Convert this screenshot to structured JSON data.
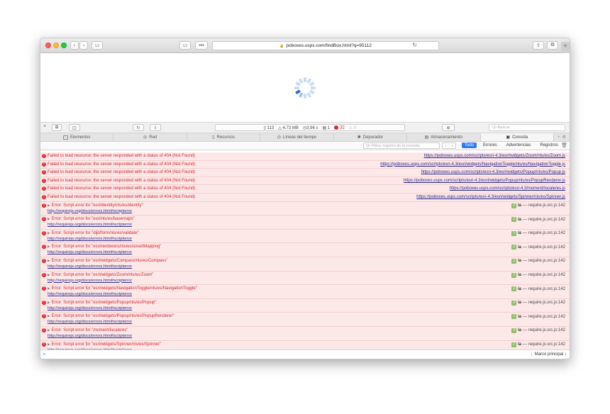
{
  "browser": {
    "url": "poboxes.usps.com/findBox.html?q=95112",
    "reader_label": "▭",
    "tabs_label": "•••|"
  },
  "devtools": {
    "stats": {
      "resources": "113",
      "size": "4,73 MB",
      "time": "3,96 s",
      "logs": "1",
      "errors": "32",
      "warnings": "0"
    },
    "search_placeholder": "Q• Buscar",
    "tabs": [
      {
        "label": "Elementos"
      },
      {
        "label": "Red"
      },
      {
        "label": "Recursos"
      },
      {
        "label": "Líneas del tiempo"
      },
      {
        "label": "Depurador"
      },
      {
        "label": "Almacenamiento"
      },
      {
        "label": "Consola"
      }
    ],
    "filter_placeholder": "Q• Filtrar registro de la consola",
    "filters": {
      "all": "Todo",
      "errors": "Errores",
      "warnings": "Advertencias",
      "logs": "Registros"
    },
    "context_label": "Marco principal ↕"
  },
  "console": {
    "resource_errors": [
      {
        "message": "Failed to load resource: the server responded with a status of 404 (Not Found)",
        "source": "https://poboxes.usps.com/scripts/esri-4.3/esri/widgets/Zoom/nls/es/Zoom.js"
      },
      {
        "message": "Failed to load resource: the server responded with a status of 404 (Not Found)",
        "source": "https://poboxes.usps.com/scripts/esri-4.3/esri/widgets/NavigationToggle/nls/es/NavigationToggle.js"
      },
      {
        "message": "Failed to load resource: the server responded with a status of 404 (Not Found)",
        "source": "https://poboxes.usps.com/scripts/esri-4.3/esri/widgets/Popup/nls/es/Popup.js"
      },
      {
        "message": "Failed to load resource: the server responded with a status of 404 (Not Found)",
        "source": "https://poboxes.usps.com/scripts/esri-4.3/esri/widgets/Popup/nls/es/PopupRenderer.js"
      },
      {
        "message": "Failed to load resource: the server responded with a status of 404 (Not Found)",
        "source": "https://poboxes.usps.com/scripts/esri-4.3/moment/locale/es.js"
      },
      {
        "message": "Failed to load resource: the server responded with a status of 404 (Not Found)",
        "source": "https://poboxes.usps.com/scripts/esri-4.3/esri/widgets/Spinner/nls/es/Spinner.js"
      }
    ],
    "script_errors": [
      {
        "message": "Error: Script error for \"esri/identity/nls/es/identity\"",
        "link": "http://requirejs.org/docs/errors.html#scripterror",
        "source_name": "ia",
        "source_sep": "—",
        "source": "require.js.src.js:142"
      },
      {
        "message": "Error: Script error for \"esri/nls/es/basemaps\"",
        "link": "http://requirejs.org/docs/errors.html#scripterror",
        "source_name": "ia",
        "source_sep": "—",
        "source": "require.js.src.js:142"
      },
      {
        "message": "Error: Script error for \"dijit/form/nls/es/validate\"",
        "link": "http://requirejs.org/docs/errors.html#scripterror",
        "source_name": "ia",
        "source_sep": "—",
        "source": "require.js.src.js:142"
      },
      {
        "message": "Error: Script error for \"esri/renderers/nls/es/smartMapping\"",
        "link": "http://requirejs.org/docs/errors.html#scripterror",
        "source_name": "ia",
        "source_sep": "—",
        "source": "require.js.src.js:142"
      },
      {
        "message": "Error: Script error for \"esri/widgets/Compass/nls/es/Compass\"",
        "link": "http://requirejs.org/docs/errors.html#scripterror",
        "source_name": "ia",
        "source_sep": "—",
        "source": "require.js.src.js:142"
      },
      {
        "message": "Error: Script error for \"esri/widgets/Zoom/nls/es/Zoom\"",
        "link": "http://requirejs.org/docs/errors.html#scripterror",
        "source_name": "ia",
        "source_sep": "—",
        "source": "require.js.src.js:142"
      },
      {
        "message": "Error: Script error for \"esri/widgets/NavigationToggle/nls/es/NavigationToggle\"",
        "link": "http://requirejs.org/docs/errors.html#scripterror",
        "source_name": "ia",
        "source_sep": "—",
        "source": "require.js.src.js:142"
      },
      {
        "message": "Error: Script error for \"esri/widgets/Popup/nls/es/Popup\"",
        "link": "http://requirejs.org/docs/errors.html#scripterror",
        "source_name": "ia",
        "source_sep": "—",
        "source": "require.js.src.js:142"
      },
      {
        "message": "Error: Script error for \"esri/widgets/Popup/nls/es/PopupRenderer\"",
        "link": "http://requirejs.org/docs/errors.html#scripterror",
        "source_name": "ia",
        "source_sep": "—",
        "source": "require.js.src.js:142"
      },
      {
        "message": "Error: Script error for \"moment/locale/es\"",
        "link": "http://requirejs.org/docs/errors.html#scripterror",
        "source_name": "ia",
        "source_sep": "—",
        "source": "require.js.src.js:142"
      },
      {
        "message": "Error: Script error for \"esri/widgets/Spinner/nls/es/Spinner\"",
        "link": "http://requirejs.org/docs/errors.html#scripterror",
        "source_name": "ia",
        "source_sep": "—",
        "source": "require.js.src.js:142"
      }
    ],
    "prompt_symbol": ">"
  },
  "colors": {
    "error_red": "#d0242c",
    "error_row_bg": "#fde8e8",
    "accent_blue": "#2f7bf5"
  }
}
